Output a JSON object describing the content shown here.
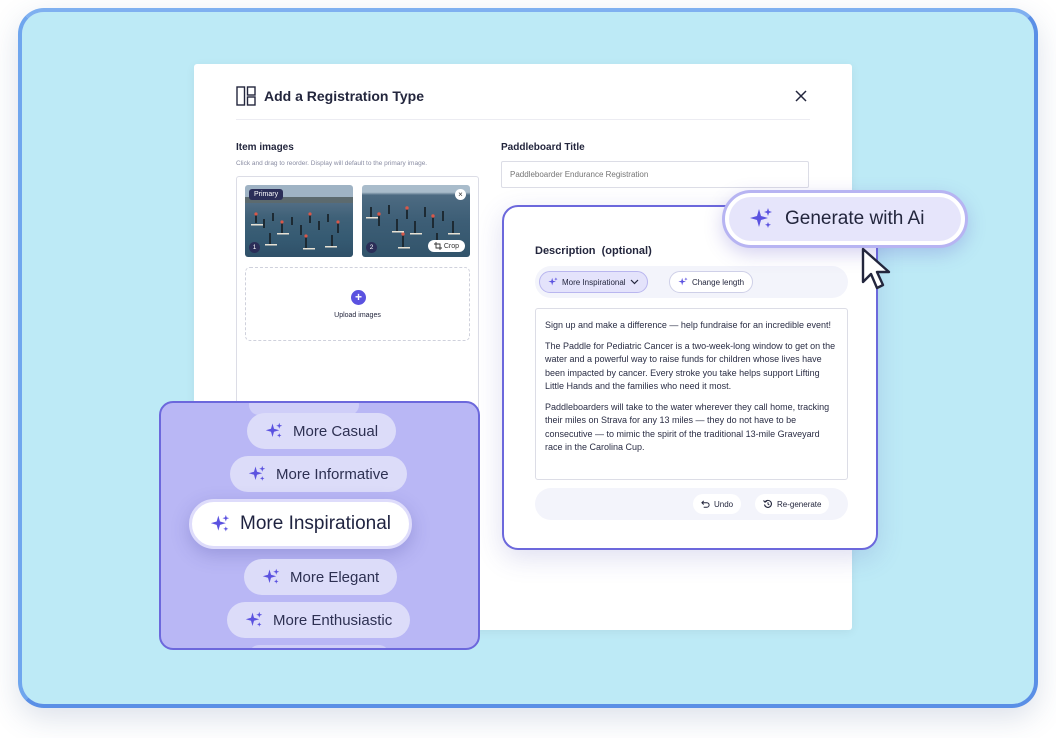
{
  "modal": {
    "title": "Add a Registration Type",
    "images_label": "Item images",
    "images_hint": "Click and drag to reorder. Display will default to the primary image.",
    "primary_badge": "Primary",
    "thumb1_num": "1",
    "thumb2_num": "2",
    "remove_glyph": "×",
    "crop_label": "Crop",
    "upload_label": "Upload images",
    "title_label": "Paddleboard Title",
    "title_placeholder": "Paddleboarder Endurance Registration"
  },
  "description": {
    "label": "Description",
    "optional": "(optional)",
    "tone_chip": "More Inspirational",
    "length_chip": "Change length",
    "paragraphs": [
      "Sign up and make a difference — help fundraise for an incredible event!",
      "The Paddle for Pediatric Cancer is a two-week-long window to get on the water and a powerful way to raise funds for children whose lives have been impacted by cancer. Every stroke you take helps support Lifting Little Hands and the families who need it most.",
      "Paddleboarders will take to the water wherever they call home, tracking their miles on Strava for any 13 miles — they do not have to be consecutive — to mimic the spirit of the traditional 13-mile Graveyard race in the Carolina Cup."
    ],
    "undo_label": "Undo",
    "regenerate_label": "Re-generate"
  },
  "generate": {
    "label": "Generate with Ai"
  },
  "tones": {
    "casual": "More Casual",
    "informative": "More Informative",
    "inspirational": "More Inspirational",
    "elegant": "More Elegant",
    "enthusiastic": "More Enthusiastic"
  },
  "colors": {
    "background": "#bdeaf6",
    "accent": "#6c68dc",
    "panel": "#b9b7f5",
    "spark": "#5b52e0"
  }
}
